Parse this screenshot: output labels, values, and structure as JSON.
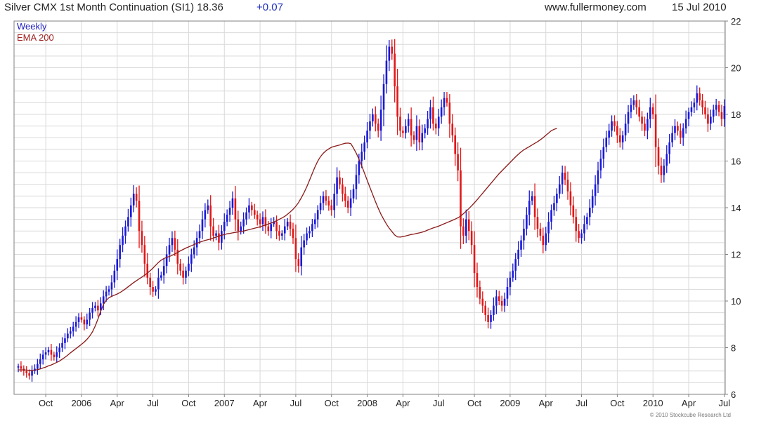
{
  "header": {
    "title": "Silver CMX 1st Month Continuation (SI1) 18.36",
    "change": "+0.07",
    "website": "www.fullermoney.com",
    "date": "15 Jul 2010"
  },
  "copyright": "© 2010 Stockcube Research Ltd",
  "colors": {
    "up": "#1a1ad6",
    "down": "#e01818",
    "ema": "#8b1a1a",
    "grid": "#d9d9d9",
    "legend_weekly": "#2020c0",
    "legend_ema": "#a02020"
  },
  "chart_data": {
    "type": "candlestick",
    "legend": [
      "Weekly",
      "EMA 200"
    ],
    "x_tick_labels": [
      "Oct",
      "2006",
      "Apr",
      "Jul",
      "Oct",
      "2007",
      "Apr",
      "Jul",
      "Oct",
      "2008",
      "Apr",
      "Jul",
      "Oct",
      "2009",
      "Apr",
      "Jul",
      "Oct",
      "2010",
      "Apr",
      "Jul"
    ],
    "x_tick_weeks": [
      10,
      23,
      36,
      49,
      62,
      75,
      88,
      101,
      114,
      127,
      140,
      153,
      166,
      179,
      192,
      205,
      218,
      231,
      244,
      257
    ],
    "y_ticks": [
      6,
      8,
      10,
      12,
      14,
      16,
      18,
      20,
      22
    ],
    "ylim": [
      6,
      22
    ],
    "last_close": 18.36,
    "closes": [
      7.2,
      7.1,
      7.0,
      6.9,
      6.8,
      7.0,
      7.1,
      7.3,
      7.5,
      7.7,
      7.8,
      7.9,
      7.7,
      7.6,
      7.8,
      8.0,
      8.2,
      8.4,
      8.6,
      8.7,
      8.9,
      9.1,
      9.3,
      9.2,
      9.0,
      9.2,
      9.5,
      9.7,
      9.8,
      9.6,
      9.9,
      10.2,
      10.4,
      10.5,
      10.8,
      11.3,
      11.8,
      12.4,
      12.8,
      13.2,
      13.6,
      14.1,
      14.6,
      14.3,
      13.0,
      12.4,
      11.6,
      11.0,
      10.6,
      10.4,
      10.5,
      11.0,
      11.1,
      11.5,
      12.0,
      12.4,
      12.7,
      12.2,
      11.6,
      11.3,
      11.0,
      11.3,
      11.6,
      12.0,
      12.3,
      12.7,
      13.0,
      13.5,
      13.9,
      14.1,
      13.2,
      12.8,
      12.9,
      12.5,
      13.0,
      13.4,
      13.7,
      14.0,
      14.4,
      13.5,
      13.0,
      13.2,
      13.5,
      13.8,
      14.1,
      13.9,
      13.7,
      13.5,
      13.3,
      13.6,
      13.2,
      13.0,
      13.3,
      13.4,
      13.0,
      12.8,
      12.9,
      13.2,
      13.4,
      13.1,
      12.7,
      11.8,
      11.5,
      12.3,
      12.6,
      12.9,
      13.0,
      13.3,
      13.5,
      13.9,
      14.2,
      14.5,
      14.3,
      14.1,
      13.9,
      14.6,
      15.3,
      15.0,
      14.6,
      14.3,
      14.0,
      14.4,
      14.8,
      15.4,
      16.0,
      16.4,
      16.8,
      17.3,
      17.7,
      18.0,
      17.6,
      17.3,
      18.2,
      19.3,
      20.3,
      20.9,
      20.6,
      19.2,
      17.9,
      17.3,
      17.2,
      17.5,
      17.8,
      17.1,
      16.9,
      17.5,
      16.8,
      17.2,
      17.4,
      17.8,
      18.3,
      17.6,
      17.4,
      17.9,
      18.3,
      18.7,
      18.5,
      17.6,
      17.1,
      16.3,
      15.6,
      13.2,
      12.8,
      13.5,
      13.0,
      12.4,
      11.2,
      10.6,
      10.1,
      9.8,
      9.4,
      9.1,
      9.4,
      9.8,
      10.2,
      10.0,
      9.8,
      10.1,
      10.6,
      11.0,
      11.3,
      11.8,
      12.2,
      12.6,
      13.1,
      13.7,
      14.3,
      14.5,
      13.6,
      13.1,
      12.8,
      12.4,
      12.9,
      13.4,
      13.9,
      14.2,
      14.6,
      15.0,
      15.5,
      15.2,
      14.7,
      14.1,
      13.6,
      13.0,
      12.7,
      12.9,
      13.3,
      13.6,
      14.0,
      14.5,
      15.0,
      15.6,
      16.1,
      16.6,
      17.0,
      17.3,
      17.7,
      17.5,
      17.1,
      16.8,
      17.1,
      17.6,
      18.1,
      18.4,
      18.6,
      18.3,
      17.9,
      17.6,
      17.3,
      17.8,
      18.3,
      18.0,
      16.6,
      15.8,
      15.4,
      15.8,
      16.3,
      16.8,
      17.2,
      17.5,
      17.3,
      17.0,
      17.4,
      17.8,
      18.1,
      18.3,
      18.5,
      18.9,
      18.6,
      18.3,
      18.0,
      17.6,
      17.9,
      18.2,
      18.4,
      18.1,
      17.8,
      18.36
    ],
    "ema200": [
      7.05,
      7.05,
      7.05,
      7.04,
      7.03,
      7.03,
      7.04,
      7.06,
      7.09,
      7.13,
      7.17,
      7.22,
      7.26,
      7.31,
      7.37,
      7.43,
      7.51,
      7.59,
      7.68,
      7.78,
      7.87,
      7.96,
      8.05,
      8.14,
      8.24,
      8.36,
      8.5,
      8.68,
      8.93,
      9.23,
      9.56,
      9.85,
      10.03,
      10.14,
      10.2,
      10.25,
      10.3,
      10.36,
      10.44,
      10.52,
      10.61,
      10.7,
      10.79,
      10.87,
      10.95,
      11.03,
      11.11,
      11.2,
      11.3,
      11.41,
      11.53,
      11.65,
      11.75,
      11.82,
      11.87,
      11.91,
      11.96,
      12.02,
      12.08,
      12.15,
      12.21,
      12.27,
      12.32,
      12.37,
      12.42,
      12.47,
      12.52,
      12.56,
      12.6,
      12.63,
      12.66,
      12.7,
      12.74,
      12.78,
      12.82,
      12.85,
      12.88,
      12.9,
      12.92,
      12.94,
      12.96,
      12.98,
      13.0,
      13.03,
      13.06,
      13.09,
      13.12,
      13.15,
      13.18,
      13.22,
      13.26,
      13.3,
      13.34,
      13.39,
      13.44,
      13.5,
      13.56,
      13.63,
      13.72,
      13.82,
      13.93,
      14.06,
      14.22,
      14.42,
      14.64,
      14.9,
      15.18,
      15.47,
      15.75,
      16.0,
      16.19,
      16.33,
      16.44,
      16.52,
      16.59,
      16.63,
      16.66,
      16.69,
      16.73,
      16.76,
      16.77,
      16.75,
      16.56,
      16.34,
      16.08,
      15.79,
      15.48,
      15.17,
      14.86,
      14.56,
      14.26,
      13.98,
      13.72,
      13.5,
      13.3,
      13.12,
      12.97,
      12.83,
      12.75,
      12.74,
      12.76,
      12.79,
      12.82,
      12.85,
      12.87,
      12.9,
      12.92,
      12.95,
      12.99,
      13.04,
      13.09,
      13.13,
      13.17,
      13.21,
      13.26,
      13.31,
      13.36,
      13.41,
      13.46,
      13.51,
      13.57,
      13.64,
      13.74,
      13.85,
      13.96,
      14.08,
      14.21,
      14.34,
      14.48,
      14.62,
      14.76,
      14.9,
      15.04,
      15.18,
      15.32,
      15.46,
      15.58,
      15.7,
      15.82,
      15.94,
      16.06,
      16.18,
      16.29,
      16.39,
      16.48,
      16.55,
      16.62,
      16.69,
      16.76,
      16.83,
      16.91,
      17.0,
      17.1,
      17.2,
      17.3,
      17.36,
      17.4
    ]
  }
}
